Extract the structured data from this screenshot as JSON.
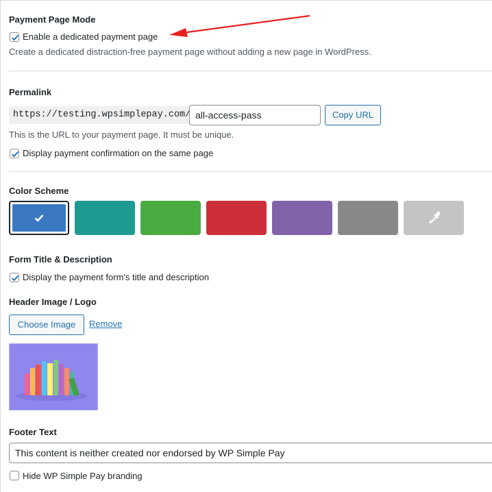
{
  "payment_page_mode": {
    "heading": "Payment Page Mode",
    "enable_label": "Enable a dedicated payment page",
    "enable_checked": true,
    "description": "Create a dedicated distraction-free payment page without adding a new page in WordPress."
  },
  "permalink": {
    "heading": "Permalink",
    "prefix": "https://testing.wpsimplepay.com/",
    "slug_value": "all-access-pass",
    "copy_button": "Copy URL",
    "description": "This is the URL to your payment page. It must be unique.",
    "confirmation_label": "Display payment confirmation on the same page",
    "confirmation_checked": true
  },
  "color_scheme": {
    "heading": "Color Scheme",
    "swatches": [
      {
        "color": "#3a78c2",
        "selected": true
      },
      {
        "color": "#1e9a91",
        "selected": false
      },
      {
        "color": "#4aab41",
        "selected": false
      },
      {
        "color": "#cc2f37",
        "selected": false
      },
      {
        "color": "#8163a9",
        "selected": false
      },
      {
        "color": "#888888",
        "selected": false
      },
      {
        "color": "#c4c4c4",
        "selected": false,
        "icon": "eyedropper-icon"
      }
    ]
  },
  "form_title": {
    "heading": "Form Title & Description",
    "display_label": "Display the payment form's title and description",
    "display_checked": true
  },
  "header_image": {
    "heading": "Header Image / Logo",
    "choose_button": "Choose Image",
    "remove_link": "Remove",
    "thumbnail_bg": "#8f86ee"
  },
  "footer": {
    "heading": "Footer Text",
    "text_value": "This content is neither created nor endorsed by WP Simple Pay",
    "hide_branding_label": "Hide WP Simple Pay branding",
    "hide_branding_checked": false
  },
  "accent_color": "#2271b1"
}
